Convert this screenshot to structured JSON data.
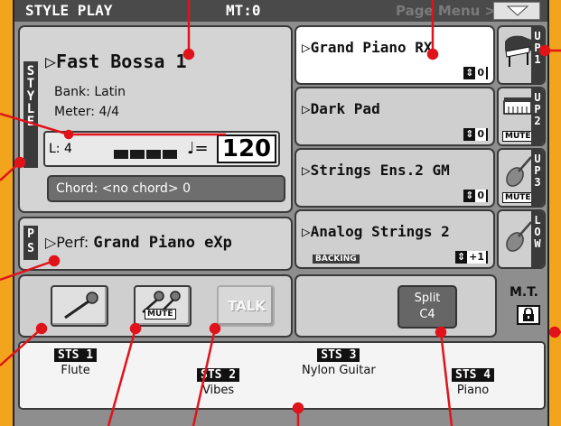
{
  "header": {
    "title": "STYLE PLAY",
    "mt": "MT:0",
    "page_menu": "Page Menu >"
  },
  "style": {
    "tab": "STYLE",
    "name": "▷Fast Bossa 1",
    "bank": "Bank:  Latin",
    "meter": "Meter:  4/4",
    "length": "L: 4",
    "tempo_note": "♩=",
    "tempo": "120",
    "chord": "Chord: <no chord> 0"
  },
  "performance": {
    "tab": "PS",
    "prefix": "▷Perf:",
    "name": "Grand Piano eXp"
  },
  "tracks": [
    {
      "name": "▷Grand Piano RX",
      "octave": "0",
      "side": "UP1",
      "mute": false,
      "backing": ""
    },
    {
      "name": "▷Dark Pad",
      "octave": "0",
      "side": "UP2",
      "mute": true,
      "backing": ""
    },
    {
      "name": "▷Strings Ens.2 GM",
      "octave": "0",
      "side": "UP3",
      "mute": true,
      "backing": ""
    },
    {
      "name": "▷Analog Strings 2",
      "octave": "+1",
      "side": "LOW",
      "mute": false,
      "backing": "BACKING"
    }
  ],
  "buttons": {
    "mute_tag": "MUTE",
    "talk": "TALK",
    "split_label": "Split",
    "split_note": "C4",
    "mt_label": "M.T."
  },
  "sts": [
    {
      "tag": "STS 1",
      "name": "Flute"
    },
    {
      "tag": "STS 2",
      "name": "Vibes"
    },
    {
      "tag": "STS 3",
      "name": "Nylon Guitar"
    },
    {
      "tag": "STS 4",
      "name": "Piano"
    }
  ],
  "colors": {
    "background": "#f2a51c",
    "callout": "#e0131a",
    "title_bar": "#4a4a4a",
    "panel": "#d4d4d4"
  }
}
